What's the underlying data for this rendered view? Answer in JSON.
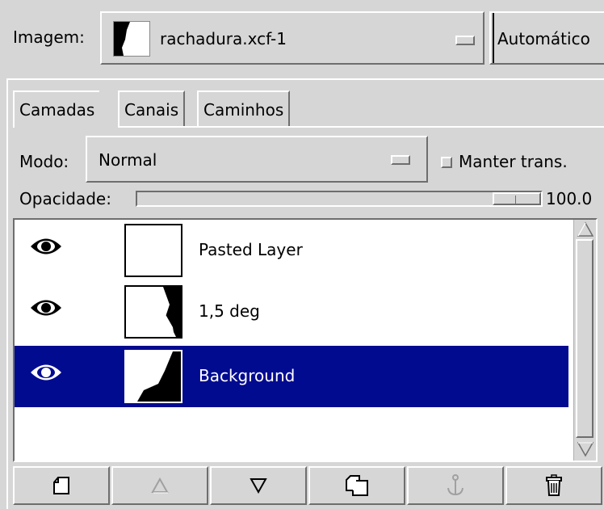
{
  "image_selector": {
    "label": "Imagem:",
    "value": "rachadura.xcf-1",
    "auto_button": "Automático"
  },
  "tabs": [
    {
      "label": "Camadas",
      "active": true
    },
    {
      "label": "Canais",
      "active": false
    },
    {
      "label": "Caminhos",
      "active": false
    }
  ],
  "mode": {
    "label": "Modo:",
    "value": "Normal",
    "keep_trans_label": "Manter trans.",
    "keep_trans_checked": false
  },
  "opacity": {
    "label": "Opacidade:",
    "value": "100.0"
  },
  "layers": [
    {
      "name": "Pasted Layer",
      "visible": true,
      "selected": false,
      "thumbnail": "transparent-white-shape"
    },
    {
      "name": "1,5 deg",
      "visible": true,
      "selected": false,
      "thumbnail": "transparent-black-white-shape"
    },
    {
      "name": "Background",
      "visible": true,
      "selected": true,
      "thumbnail": "white-black-shape"
    }
  ],
  "toolbar": [
    {
      "icon": "new-layer-icon",
      "enabled": true
    },
    {
      "icon": "raise-layer-icon",
      "enabled": false
    },
    {
      "icon": "lower-layer-icon",
      "enabled": true
    },
    {
      "icon": "duplicate-layer-icon",
      "enabled": true
    },
    {
      "icon": "anchor-layer-icon",
      "enabled": false
    },
    {
      "icon": "delete-layer-icon",
      "enabled": true
    }
  ],
  "colors": {
    "selection": "#000b90",
    "background": "#d6d6d6"
  }
}
